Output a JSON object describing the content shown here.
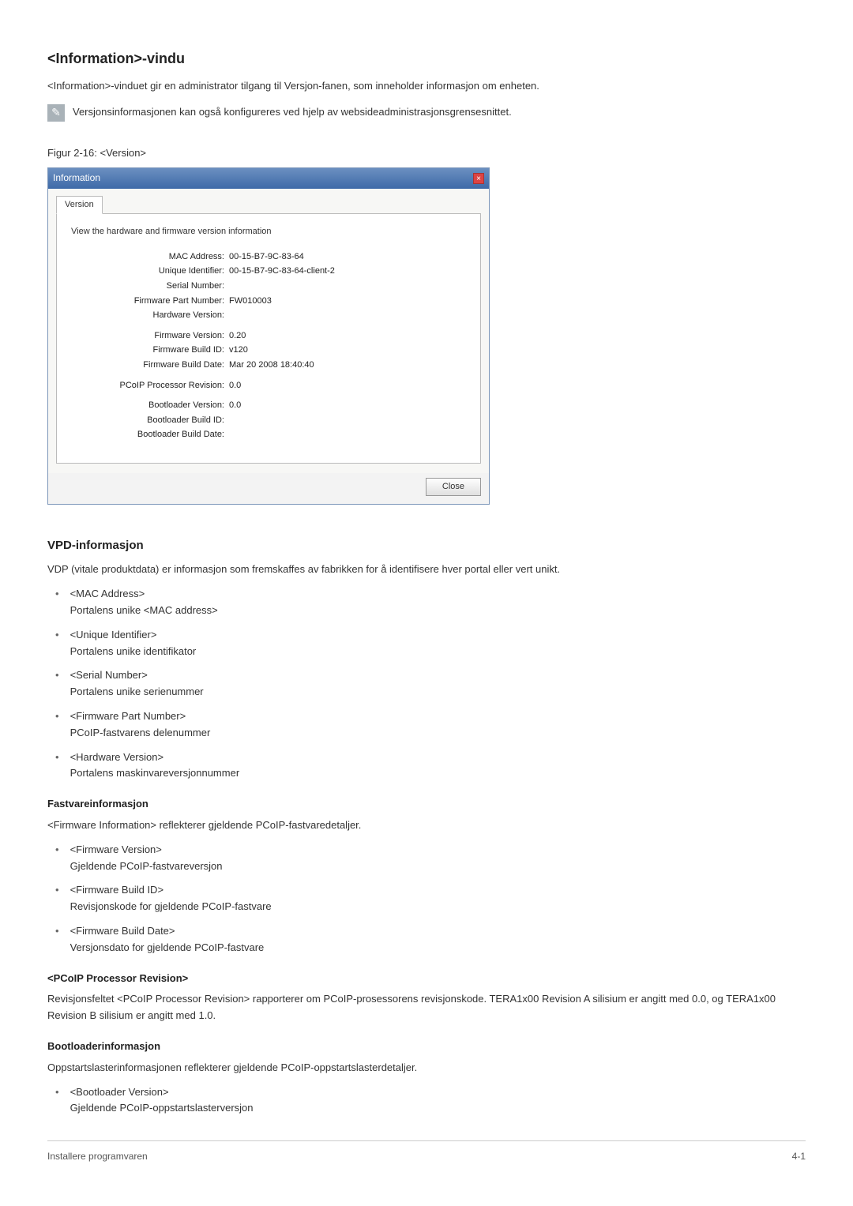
{
  "headings": {
    "page_title": "<Information>-vindu",
    "figure_caption": "Figur 2-16: <Version>",
    "vpd": "VPD-informasjon",
    "fastvare": "Fastvareinformasjon",
    "pcoip": "<PCoIP Processor Revision>",
    "bootloader": "Bootloaderinformasjon"
  },
  "paragraphs": {
    "intro": "<Information>-vinduet gir en administrator tilgang til Versjon-fanen, som inneholder informasjon om enheten.",
    "note": "Versjonsinformasjonen kan også konfigureres ved hjelp av websideadministrasjonsgrensesnittet.",
    "vpd_intro": "VDP (vitale produktdata) er informasjon som fremskaffes av fabrikken for å identifisere hver portal eller vert unikt.",
    "fastvare_intro": "<Firmware Information> reflekterer gjeldende PCoIP-fastvaredetaljer.",
    "pcoip_intro": "Revisjonsfeltet <PCoIP Processor Revision> rapporterer om PCoIP-prosessorens revisjonskode. TERA1x00 Revision A silisium er angitt med 0.0, og TERA1x00 Revision B silisium er angitt med 1.0.",
    "bootloader_intro": "Oppstartslasterinformasjonen reflekterer gjeldende PCoIP-oppstartslasterdetaljer."
  },
  "dialog": {
    "title": "Information",
    "tab_label": "Version",
    "description": "View the hardware and firmware version information",
    "close_button": "Close",
    "groups": [
      [
        {
          "k": "MAC Address:",
          "v": "00-15-B7-9C-83-64"
        },
        {
          "k": "Unique Identifier:",
          "v": "00-15-B7-9C-83-64-client-2"
        },
        {
          "k": "Serial Number:",
          "v": ""
        },
        {
          "k": "Firmware Part Number:",
          "v": "FW010003"
        },
        {
          "k": "Hardware Version:",
          "v": ""
        }
      ],
      [
        {
          "k": "Firmware Version:",
          "v": "0.20"
        },
        {
          "k": "Firmware Build ID:",
          "v": "v120"
        },
        {
          "k": "Firmware Build Date:",
          "v": "Mar 20 2008 18:40:40"
        }
      ],
      [
        {
          "k": "PCoIP Processor Revision:",
          "v": "0.0"
        }
      ],
      [
        {
          "k": "Bootloader Version:",
          "v": "0.0"
        },
        {
          "k": "Bootloader Build ID:",
          "v": ""
        },
        {
          "k": "Bootloader Build Date:",
          "v": ""
        }
      ]
    ]
  },
  "vpd_items": [
    {
      "t": "<MAC Address>",
      "d": "Portalens unike <MAC address>"
    },
    {
      "t": "<Unique Identifier>",
      "d": "Portalens unike identifikator"
    },
    {
      "t": "<Serial Number>",
      "d": "Portalens unike serienummer"
    },
    {
      "t": "<Firmware Part Number>",
      "d": "PCoIP-fastvarens delenummer"
    },
    {
      "t": "<Hardware Version>",
      "d": "Portalens maskinvareversjonnummer"
    }
  ],
  "fastvare_items": [
    {
      "t": "<Firmware Version>",
      "d": "Gjeldende PCoIP-fastvareversjon"
    },
    {
      "t": "<Firmware Build ID>",
      "d": "Revisjonskode for gjeldende PCoIP-fastvare"
    },
    {
      "t": "<Firmware Build Date>",
      "d": "Versjonsdato for gjeldende PCoIP-fastvare"
    }
  ],
  "bootloader_items": [
    {
      "t": "<Bootloader Version>",
      "d": "Gjeldende PCoIP-oppstartslasterversjon"
    }
  ],
  "footer": {
    "left": "Installere programvaren",
    "right": "4-1"
  }
}
